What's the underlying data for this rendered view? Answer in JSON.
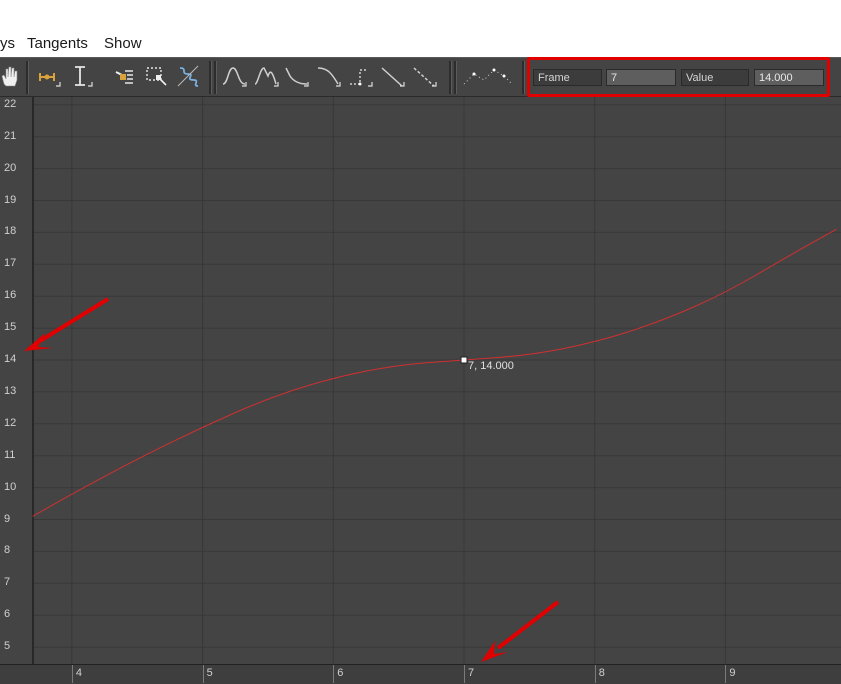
{
  "menu": {
    "items": [
      "ys",
      "Tangents",
      "Show"
    ]
  },
  "toolbar": {
    "icons": [
      "pan-hand-icon",
      "move-keys-icon",
      "scale-keys-vertical-icon",
      "add-keys-icon",
      "region-select-icon",
      "draw-curve-icon",
      "auto-tangent-icon",
      "custom-tangent-icon",
      "fast-tangent-icon",
      "slow-tangent-icon",
      "step-tangent-icon",
      "linear-tangent-icon",
      "smooth-tangent-icon",
      "show-keys-icon"
    ],
    "key_fields": {
      "frame_label": "Frame",
      "frame_value": "7",
      "value_label": "Value",
      "value_value": "14.000"
    }
  },
  "graph": {
    "y_ticks": [
      "22",
      "21",
      "20",
      "19",
      "18",
      "17",
      "16",
      "15",
      "14",
      "13",
      "12",
      "11",
      "10",
      "9",
      "8",
      "7",
      "6",
      "5"
    ],
    "x_ticks": [
      "4",
      "5",
      "6",
      "7",
      "8",
      "9"
    ],
    "selected_key": {
      "frame": 7,
      "value": 14.0,
      "label": "7, 14.000"
    },
    "curve": {
      "color": "#d03030",
      "points": [
        [
          3.7,
          9.1
        ],
        [
          4.0,
          9.8
        ],
        [
          4.5,
          10.9
        ],
        [
          5.0,
          11.9
        ],
        [
          5.5,
          12.8
        ],
        [
          6.0,
          13.45
        ],
        [
          6.5,
          13.85
        ],
        [
          7.0,
          14.0
        ],
        [
          7.5,
          14.15
        ],
        [
          8.0,
          14.55
        ],
        [
          8.5,
          15.2
        ],
        [
          9.0,
          16.1
        ],
        [
          9.5,
          17.3
        ],
        [
          9.85,
          18.1
        ]
      ]
    }
  },
  "annotations": {
    "arrow_color": "#e00000",
    "highlight_color": "#e00000"
  }
}
